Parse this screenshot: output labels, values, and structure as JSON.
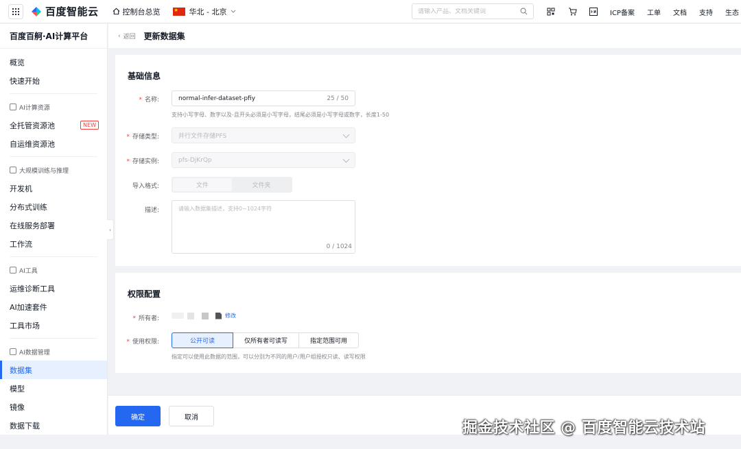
{
  "topbar": {
    "brand": "百度智能云",
    "console_home": "控制台总览",
    "region": "华北 - 北京",
    "search_placeholder": "请输入产品、文档关键词",
    "links": [
      "ICP备案",
      "工单",
      "文档",
      "支持",
      "生态"
    ]
  },
  "sidebar": {
    "title": "百度百舸·AI计算平台",
    "top_items": [
      "概览",
      "快速开始"
    ],
    "groups": [
      {
        "label": "AI计算资源",
        "items": [
          {
            "label": "全托管资源池",
            "badge": "NEW"
          },
          {
            "label": "自运维资源池"
          }
        ]
      },
      {
        "label": "大规模训练与推理",
        "items": [
          {
            "label": "开发机"
          },
          {
            "label": "分布式训练"
          },
          {
            "label": "在线服务部署"
          },
          {
            "label": "工作流"
          }
        ]
      },
      {
        "label": "AI工具",
        "items": [
          {
            "label": "运维诊断工具"
          },
          {
            "label": "AI加速套件"
          },
          {
            "label": "工具市场"
          }
        ]
      },
      {
        "label": "AI数据管理",
        "items": [
          {
            "label": "数据集",
            "active": true
          },
          {
            "label": "模型"
          },
          {
            "label": "镜像"
          },
          {
            "label": "数据下载"
          }
        ]
      }
    ]
  },
  "breadcrumb": {
    "back": "返回",
    "title": "更新数据集"
  },
  "basic": {
    "title": "基础信息",
    "name_label": "名称:",
    "name_value": "normal-infer-dataset-pfiy",
    "name_count": "25 / 50",
    "name_help": "支持小写字母、数字以及-且开头必须是小写字母，结尾必须是小写字母或数字，长度1-50",
    "storage_type_label": "存储类型:",
    "storage_type_value": "并行文件存储PFS",
    "storage_instance_label": "存储实例:",
    "storage_instance_value": "pfs-DjKrQp",
    "import_label": "导入格式:",
    "import_options": [
      "文件",
      "文件夹"
    ],
    "desc_label": "描述:",
    "desc_placeholder": "请输入数据集描述，支持0~1024字符",
    "desc_count": "0 / 1024"
  },
  "permission": {
    "title": "权限配置",
    "owner_label": "所有者:",
    "modify": "修改",
    "usage_label": "使用权限:",
    "options": [
      "公开可读",
      "仅所有者可读写",
      "指定范围可用"
    ],
    "help": "指定可以使用此数据的范围，可以分别为不同的用户/用户组授权只读、读写权限"
  },
  "footer": {
    "confirm": "确定",
    "cancel": "取消"
  },
  "watermark": "掘金技术社区 @ 百度智能云技术站",
  "colors": {
    "primary": "#2468f2",
    "required": "#f33e3e"
  }
}
